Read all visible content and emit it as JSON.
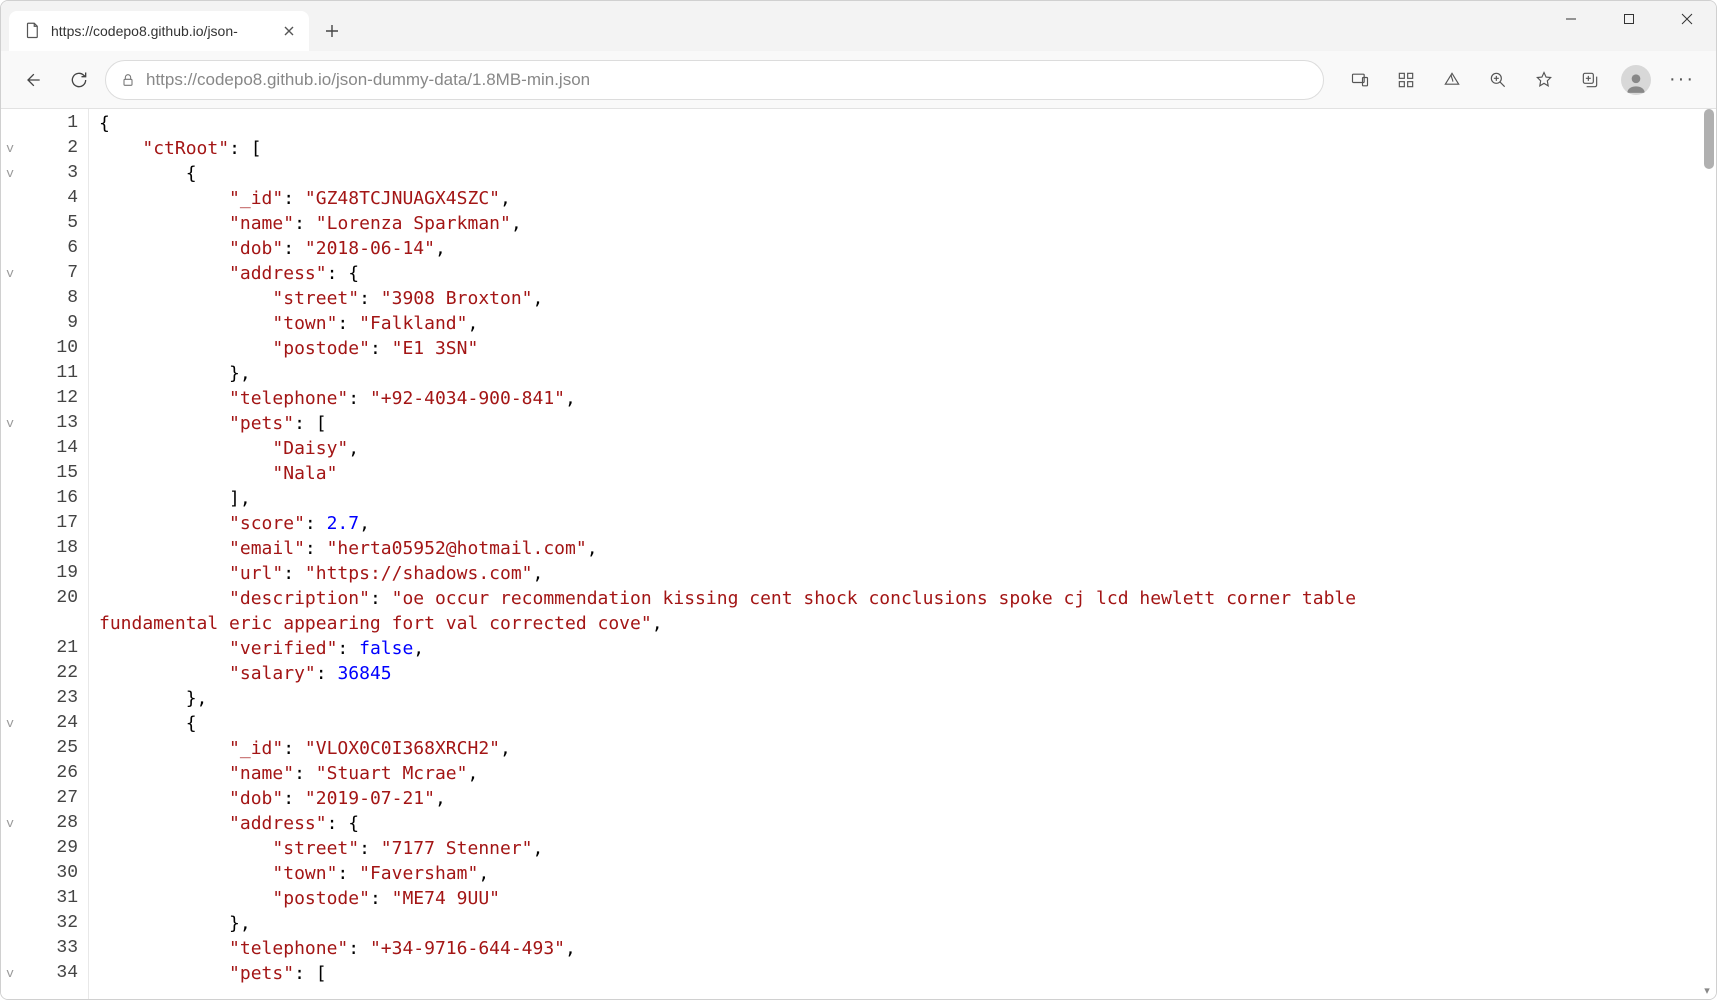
{
  "tab": {
    "title": "https://codepo8.github.io/json-"
  },
  "toolbar": {
    "url": "https://codepo8.github.io/json-dummy-data/1.8MB-min.json"
  },
  "json_content": {
    "root_key": "ctRoot",
    "records": [
      {
        "_id": "GZ48TCJNUAGX4SZC",
        "name": "Lorenza Sparkman",
        "dob": "2018-06-14",
        "address": {
          "street": "3908 Broxton",
          "town": "Falkland",
          "postode": "E1 3SN"
        },
        "telephone": "+92-4034-900-841",
        "pets": [
          "Daisy",
          "Nala"
        ],
        "score": 2.7,
        "email": "herta05952@hotmail.com",
        "url": "https://shadows.com",
        "description": "oe occur recommendation kissing cent shock conclusions spoke cj lcd hewlett corner table fundamental eric appearing fort val corrected cove",
        "verified": false,
        "salary": 36845
      },
      {
        "_id": "VLOX0C0I368XRCH2",
        "name": "Stuart Mcrae",
        "dob": "2019-07-21",
        "address": {
          "street": "7177 Stenner",
          "town": "Faversham",
          "postode": "ME74 9UU"
        },
        "telephone": "+34-9716-644-493",
        "pets": []
      }
    ]
  },
  "fold_markers": {
    "2": "v",
    "3": "v",
    "7": "v",
    "13": "v",
    "24": "v",
    "28": "v",
    "34": "v"
  },
  "colors": {
    "json_key_string": "#a31515",
    "json_number_bool": "#0000ff",
    "punctuation": "#000000"
  }
}
